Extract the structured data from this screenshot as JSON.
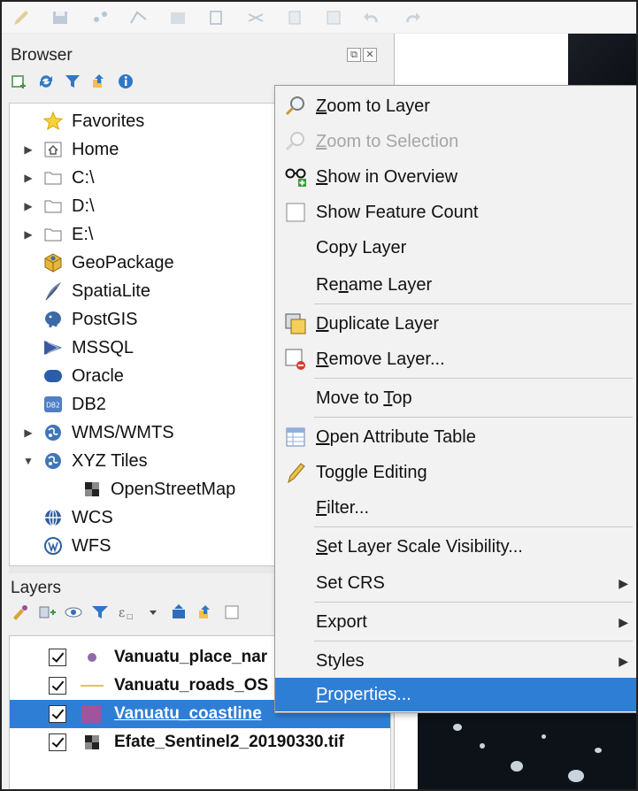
{
  "browser": {
    "title": "Browser",
    "dock_float": "⧉",
    "dock_close": "✕",
    "tree": [
      {
        "label": "Favorites",
        "icon": "star-icon",
        "expandable": false
      },
      {
        "label": "Home",
        "icon": "home-folder-icon",
        "expandable": true
      },
      {
        "label": "C:\\",
        "icon": "folder-icon",
        "expandable": true
      },
      {
        "label": "D:\\",
        "icon": "folder-icon",
        "expandable": true
      },
      {
        "label": "E:\\",
        "icon": "folder-icon",
        "expandable": true
      },
      {
        "label": "GeoPackage",
        "icon": "geopackage-icon",
        "expandable": false
      },
      {
        "label": "SpatiaLite",
        "icon": "spatialite-icon",
        "expandable": false
      },
      {
        "label": "PostGIS",
        "icon": "postgis-icon",
        "expandable": false
      },
      {
        "label": "MSSQL",
        "icon": "mssql-icon",
        "expandable": false
      },
      {
        "label": "Oracle",
        "icon": "oracle-icon",
        "expandable": false
      },
      {
        "label": "DB2",
        "icon": "db2-icon",
        "expandable": false
      },
      {
        "label": "WMS/WMTS",
        "icon": "wms-icon",
        "expandable": true
      },
      {
        "label": "XYZ Tiles",
        "icon": "xyz-icon",
        "expandable": true,
        "expanded": true
      },
      {
        "label": "OpenStreetMap",
        "icon": "tiles-icon",
        "expandable": false,
        "child": true
      },
      {
        "label": "WCS",
        "icon": "wcs-icon",
        "expandable": false
      },
      {
        "label": "WFS",
        "icon": "wfs-icon",
        "expandable": false
      }
    ]
  },
  "layers": {
    "title": "Layers",
    "items": [
      {
        "name": "Vanuatu_place_nar",
        "symbol": "point-symbol",
        "checked": true,
        "selected": false
      },
      {
        "name": "Vanuatu_roads_OS",
        "symbol": "line-symbol",
        "checked": true,
        "selected": false
      },
      {
        "name": "Vanuatu_coastline",
        "symbol": "polygon-symbol",
        "checked": true,
        "selected": true
      },
      {
        "name": "Efate_Sentinel2_20190330.tif",
        "symbol": "raster-symbol",
        "checked": true,
        "selected": false
      }
    ]
  },
  "context_menu": {
    "items": [
      {
        "label": "Zoom to Layer",
        "u": "Z",
        "icon": "zoom-layer-icon",
        "state": "normal",
        "submenu": false
      },
      {
        "label": "Zoom to Selection",
        "u": "Z",
        "icon": "zoom-selection-icon",
        "state": "disabled",
        "submenu": false
      },
      {
        "label": "Show in Overview",
        "u": "S",
        "icon": "overview-icon",
        "state": "normal",
        "submenu": false
      },
      {
        "label": "Show Feature Count",
        "u": "",
        "icon": "checkbox-icon",
        "state": "normal",
        "submenu": false
      },
      {
        "label": "Copy Layer",
        "u": "",
        "icon": "",
        "state": "normal",
        "submenu": false
      },
      {
        "label": "Rename Layer",
        "u": "n",
        "icon": "",
        "state": "normal",
        "submenu": false
      },
      {
        "label": "Duplicate Layer",
        "u": "D",
        "icon": "duplicate-layer-icon",
        "state": "normal",
        "submenu": false
      },
      {
        "label": "Remove Layer...",
        "u": "R",
        "icon": "remove-layer-icon",
        "state": "normal",
        "submenu": false
      },
      {
        "label": "Move to Top",
        "u": "T",
        "icon": "",
        "state": "normal",
        "submenu": false
      },
      {
        "label": "Open Attribute Table",
        "u": "O",
        "icon": "attribute-table-icon",
        "state": "normal",
        "submenu": false
      },
      {
        "label": "Toggle Editing",
        "u": "",
        "icon": "pencil-icon",
        "state": "normal",
        "submenu": false
      },
      {
        "label": "Filter...",
        "u": "F",
        "icon": "",
        "state": "normal",
        "submenu": false
      },
      {
        "label": "Set Layer Scale Visibility...",
        "u": "S",
        "icon": "",
        "state": "normal",
        "submenu": false
      },
      {
        "label": "Set CRS",
        "u": "",
        "icon": "",
        "state": "normal",
        "submenu": true
      },
      {
        "label": "Export",
        "u": "",
        "icon": "",
        "state": "normal",
        "submenu": true
      },
      {
        "label": "Styles",
        "u": "",
        "icon": "",
        "state": "normal",
        "submenu": true
      },
      {
        "label": "Properties...",
        "u": "P",
        "icon": "",
        "state": "highlight",
        "submenu": false
      }
    ]
  },
  "colors": {
    "selection": "#2f7ed6",
    "menu_bg": "#f2f2f2",
    "panel_bg": "#f0f0f0",
    "polygon_fill": "#a0549b"
  }
}
